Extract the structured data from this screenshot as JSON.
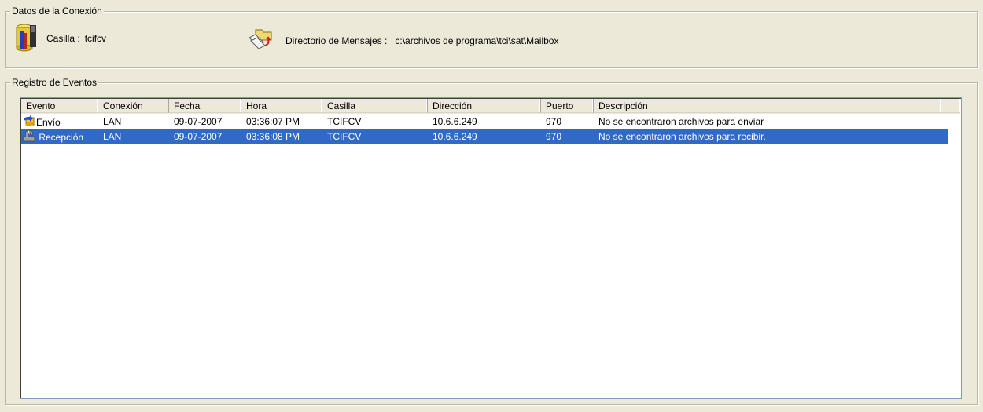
{
  "connection": {
    "legend": "Datos de la Conexión",
    "casilla_label": "Casilla :",
    "casilla_value": "tcifcv",
    "directorio_label": "Directorio de Mensajes :",
    "directorio_value": "c:\\archivos de programa\\tci\\sat\\Mailbox",
    "icons": [
      "database-tools-icon",
      "folder-transfer-icon"
    ]
  },
  "events": {
    "legend": "Registro de Eventos",
    "columns": [
      "Evento",
      "Conexión",
      "Fecha",
      "Hora",
      "Casilla",
      "Dirección",
      "Puerto",
      "Descripción"
    ],
    "rows": [
      {
        "evento": "Envío",
        "conexion": "LAN",
        "fecha": "09-07-2007",
        "hora": "03:36:07 PM",
        "casilla": "TCIFCV",
        "direccion": "10.6.6.249",
        "puerto": "970",
        "descripcion": "No se encontraron archivos para enviar",
        "icon": "send-arrows-icon",
        "selected": false
      },
      {
        "evento": "Recepción",
        "conexion": "LAN",
        "fecha": "09-07-2007",
        "hora": "03:36:08 PM",
        "casilla": "TCIFCV",
        "direccion": "10.6.6.249",
        "puerto": "970",
        "descripcion": "No se encontraron archivos para recibir.",
        "icon": "receive-hand-icon",
        "selected": true
      }
    ]
  },
  "colors": {
    "background": "#ece9d8",
    "selection": "#316ac5",
    "selection_text": "#ffffff"
  }
}
